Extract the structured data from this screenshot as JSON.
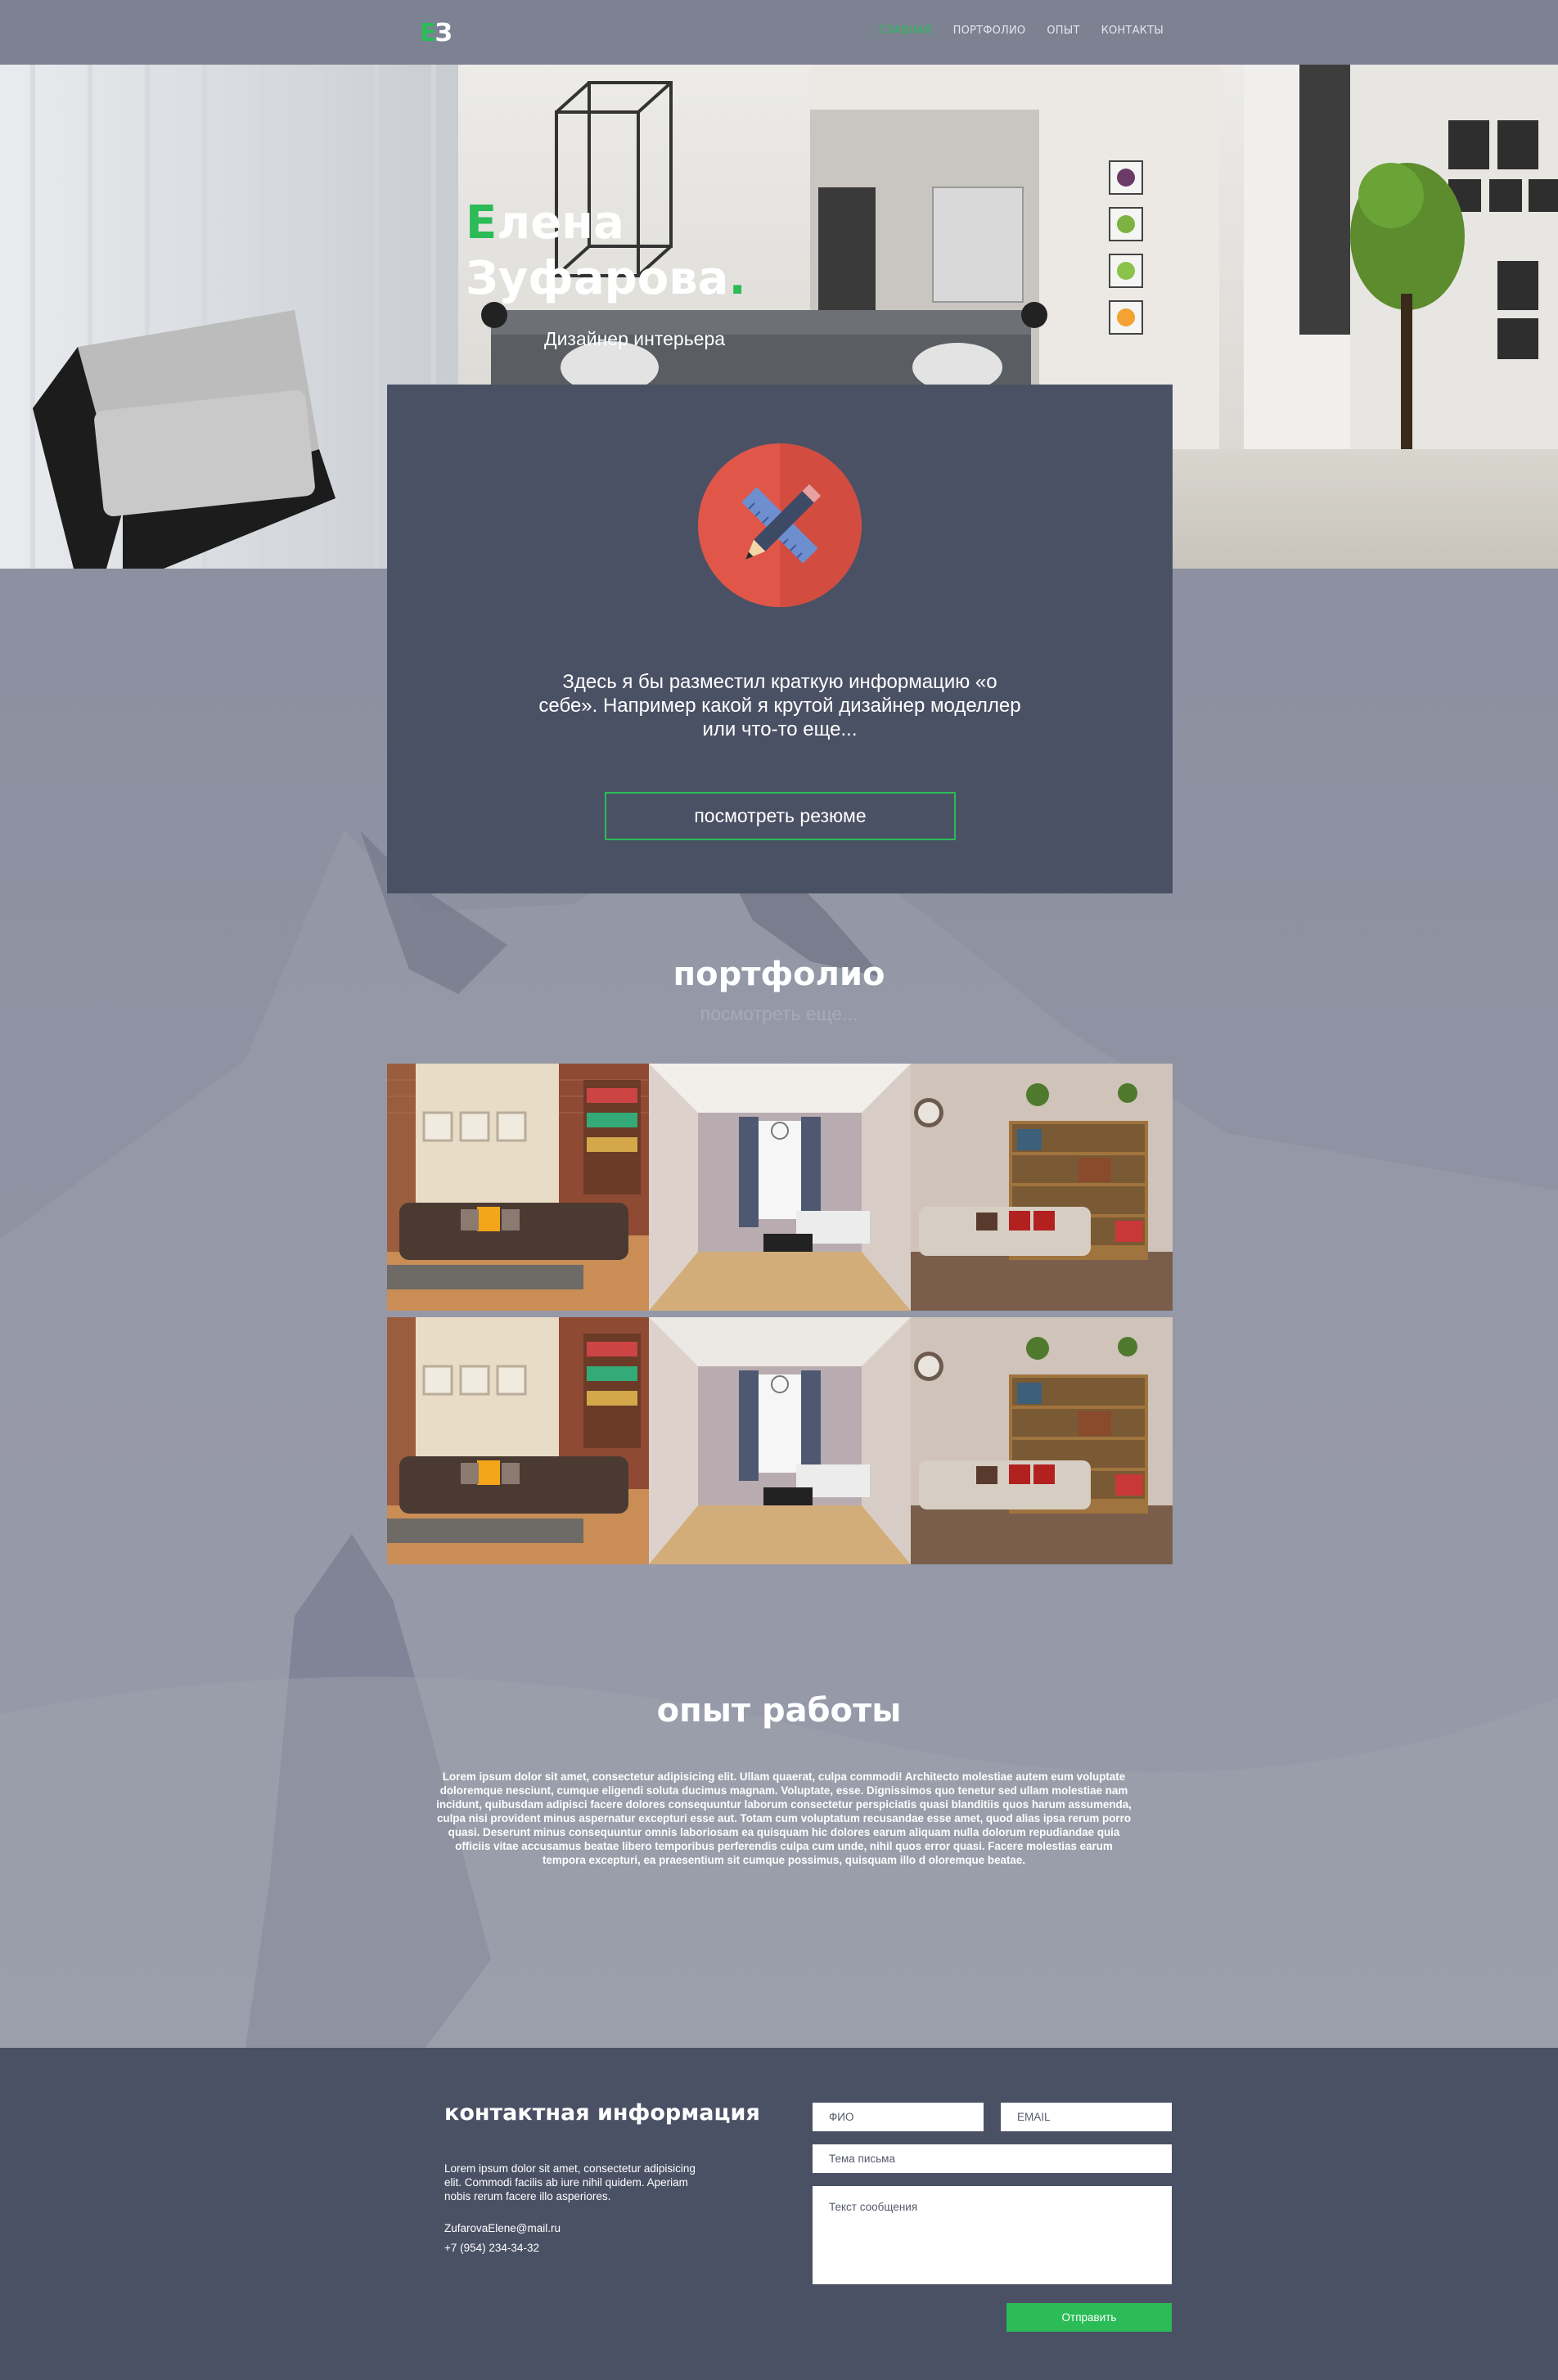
{
  "brand": {
    "logo_text_1": "Е",
    "logo_text_2": "З"
  },
  "nav": {
    "items": [
      {
        "label": "ГЛАВНАЯ",
        "active": true
      },
      {
        "label": "ПОРТФОЛИО",
        "active": false
      },
      {
        "label": "ОПЫТ",
        "active": false
      },
      {
        "label": "КОНТАКТЫ",
        "active": false
      }
    ]
  },
  "hero": {
    "first_initial": "Е",
    "first_rest": "лена",
    "last_name": "Зуфарова",
    "dot": ".",
    "subtitle": "Дизайнер интерьера"
  },
  "about": {
    "icon": "pencil-ruler-icon",
    "text": "Здесь я бы разместил краткую информацию «о себе». Например какой я крутой дизайнер моделлер или что-то еще...",
    "button_label": "посмотреть резюме"
  },
  "portfolio": {
    "title": "портфолио",
    "more": "посмотреть еще...",
    "tiles": [
      "interior-brick-room",
      "interior-white-room",
      "interior-bookshelf-room",
      "interior-brick-room",
      "interior-white-room",
      "interior-bookshelf-room"
    ]
  },
  "experience": {
    "title": "опыт работы",
    "text": "Lorem ipsum dolor sit amet, consectetur adipisicing elit. Ullam quaerat, culpa commodi! Architecto molestiae autem eum voluptate doloremque nesciunt, cumque eligendi soluta ducimus magnam. Voluptate, esse. Dignissimos quo tenetur sed ullam molestiae nam incidunt, quibusdam adipisci facere dolores consequuntur laborum consectetur perspiciatis quasi blanditiis quos harum assumenda, culpa nisi provident minus aspernatur excepturi esse aut. Totam cum voluptatum recusandae esse amet, quod alias ipsa rerum porro quasi. Deserunt minus consequuntur omnis laboriosam ea quisquam hic dolores earum aliquam nulla dolorum repudiandae quia officiis vitae accusamus beatae libero temporibus perferendis culpa cum unde, nihil quos error quasi. Facere molestias earum tempora excepturi, ea praesentium sit cumque possimus, quisquam illo d oloremque beatae."
  },
  "contact": {
    "title": "контактная информация",
    "text": "Lorem ipsum dolor sit amet, consectetur adipisicing elit. Commodi facilis ab iure nihil quidem. Aperiam nobis rerum facere illo asperiores.",
    "email": "ZufarovaElene@mail.ru",
    "phone": "+7 (954) 234-34-32",
    "form": {
      "name_placeholder": "ФИО",
      "email_placeholder": "EMAIL",
      "subject_placeholder": "Тема письма",
      "message_placeholder": "Текст сообщения",
      "send_label": "Отправить"
    }
  },
  "colors": {
    "accent": "#2bbb57",
    "panel": "#4b5165",
    "header": "#7d8292",
    "icon_red": "#e0574a"
  }
}
